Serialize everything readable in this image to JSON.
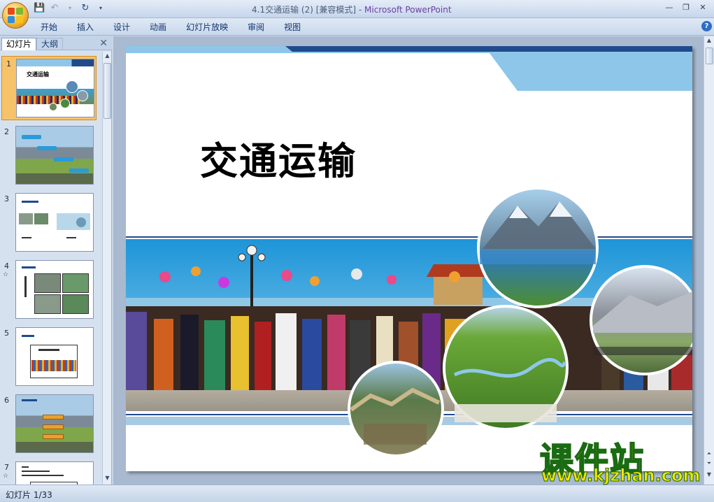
{
  "window": {
    "title_file": "4.1交通运输 (2) [兼容模式]",
    "title_sep": " - ",
    "title_app": "Microsoft PowerPoint"
  },
  "quick_access": {
    "icons": [
      "save-icon",
      "undo-icon",
      "redo-icon",
      "customize-icon"
    ]
  },
  "ribbon": {
    "tabs": [
      "开始",
      "插入",
      "设计",
      "动画",
      "幻灯片放映",
      "审阅",
      "视图"
    ]
  },
  "left_pane": {
    "tab_slides": "幻灯片",
    "tab_outline": "大纲",
    "close_glyph": "✕",
    "thumbnails": [
      {
        "num": "1",
        "anim": "",
        "title": "交通运输"
      },
      {
        "num": "2",
        "anim": "",
        "title": ""
      },
      {
        "num": "3",
        "anim": "",
        "title": ""
      },
      {
        "num": "4",
        "anim": "☆",
        "title": ""
      },
      {
        "num": "5",
        "anim": "",
        "title": ""
      },
      {
        "num": "6",
        "anim": "",
        "title": ""
      },
      {
        "num": "7",
        "anim": "☆",
        "title": ""
      }
    ]
  },
  "slide": {
    "title": "交通运输"
  },
  "status": {
    "slide_counter": "幻灯片 1/33"
  },
  "watermark": {
    "cn": "课件站",
    "url": "www.kjzhan.com"
  },
  "colors": {
    "accent_blue": "#1f4a8c",
    "light_blue": "#8ec6ea",
    "selected_thumb": "#f6c36b"
  }
}
